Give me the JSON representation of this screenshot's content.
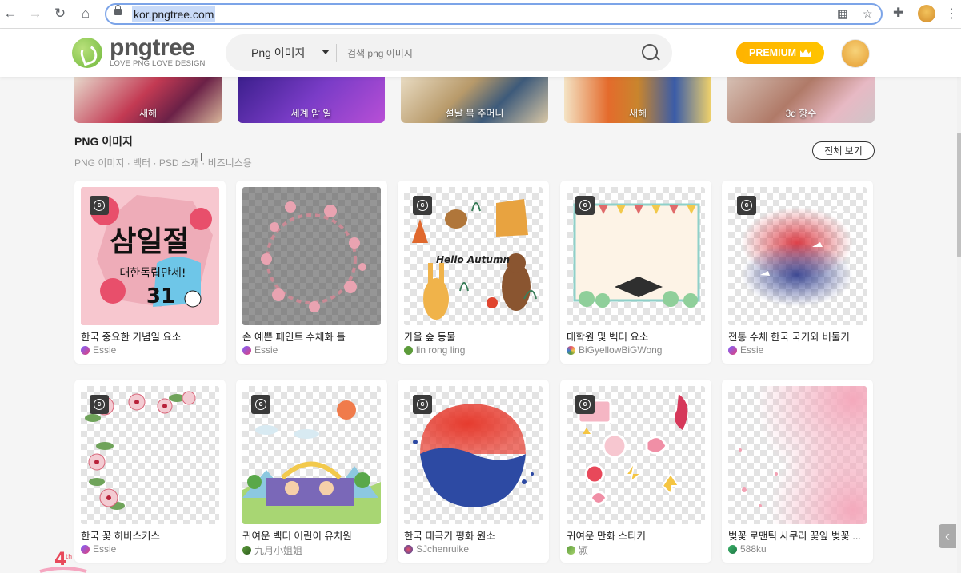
{
  "browser": {
    "url": "kor.pngtree.com"
  },
  "header": {
    "logo_word": "pngtree",
    "logo_tagline": "LOVE PNG LOVE DESIGN",
    "search_type": "Png 이미지",
    "search_placeholder": "검색 png 이미지",
    "premium_label": "PREMIUM"
  },
  "banners": [
    {
      "label": "새해"
    },
    {
      "label": "세계 암 일"
    },
    {
      "label": "설날 복 주머니"
    },
    {
      "label": "새해"
    },
    {
      "label": "3d 향수"
    }
  ],
  "section": {
    "title": "PNG 이미지",
    "subtitle": "PNG 이미지 · 벡터 · PSD 소재 · 비즈니스용",
    "view_all": "전체 보기"
  },
  "cards": [
    {
      "title": "한국 중요한 기념일 요소",
      "author": "Essie"
    },
    {
      "title": "손 예쁜 페인트 수채화 틀",
      "author": "Essie"
    },
    {
      "title": "가을 숲 동물",
      "author": "lin rong ling"
    },
    {
      "title": "대학원 및 벡터 요소",
      "author": "BiGyellowBiGWong"
    },
    {
      "title": "전통 수채 한국 국기와 비둘기",
      "author": "Essie"
    },
    {
      "title": "한국 꽃 히비스커스",
      "author": "Essie"
    },
    {
      "title": "귀여운 벡터 어린이 유치원",
      "author": "九月小姐姐"
    },
    {
      "title": "한국 태극기 평화 원소",
      "author": "SJchenruike"
    },
    {
      "title": "귀여운 만화 스티커",
      "author": "颍"
    },
    {
      "title": "벚꽃 로맨틱 사쿠라 꽃잎 벚꽃 ...",
      "author": "588ku"
    }
  ],
  "card_art_texts": {
    "c0_line1": "삼일절",
    "c0_line2": "대한독립만세!",
    "c0_line3": "31",
    "c2_text": "Hello Autumn"
  }
}
